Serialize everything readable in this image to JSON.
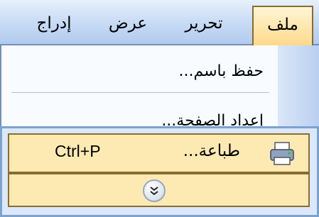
{
  "menubar": {
    "items": [
      {
        "label": "ملف",
        "active": true
      },
      {
        "label": "تحرير",
        "active": false
      },
      {
        "label": "عرض",
        "active": false
      },
      {
        "label": "إدراج",
        "active": false
      }
    ]
  },
  "dropdown": {
    "items": [
      {
        "label": "حفظ باسم..."
      },
      {
        "label": "إعداد الصفحة..."
      }
    ]
  },
  "panel": {
    "print": {
      "label": "طباعة...",
      "shortcut": "Ctrl+P",
      "icon": "printer-icon"
    },
    "expand_icon": "chevron-double-down-icon"
  },
  "colors": {
    "menubar": "#c3d8f3",
    "highlight": "#fdeab3",
    "highlight_border": "#8a6d2d",
    "panel": "#dbe8fb"
  }
}
